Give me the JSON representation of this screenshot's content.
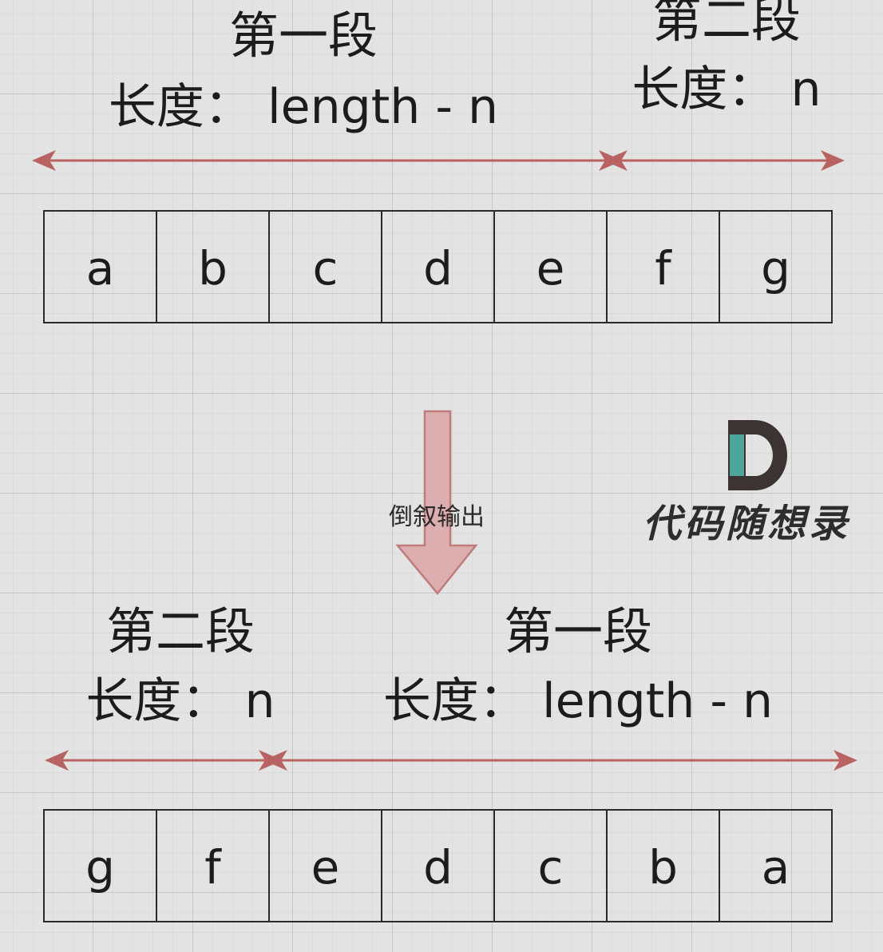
{
  "top": {
    "segment1": {
      "name": "第一段",
      "length": "长度： length - n"
    },
    "segment2": {
      "name": "第二段",
      "length": "长度： n"
    },
    "cells": [
      "a",
      "b",
      "c",
      "d",
      "e",
      "f",
      "g"
    ]
  },
  "transform": {
    "label": "倒叙输出"
  },
  "bottom": {
    "segment1": {
      "name": "第二段",
      "length": "长度： n"
    },
    "segment2": {
      "name": "第一段",
      "length": "长度： length - n"
    },
    "cells": [
      "g",
      "f",
      "e",
      "d",
      "c",
      "b",
      "a"
    ]
  },
  "logo": {
    "text": "代码随想录"
  },
  "colors": {
    "range_arrow": "#b86362",
    "down_arrow_fill": "#ddaeb0",
    "down_arrow_stroke": "#c07b7b",
    "logo_dark": "#3b3433",
    "logo_teal": "#4ea59b"
  }
}
